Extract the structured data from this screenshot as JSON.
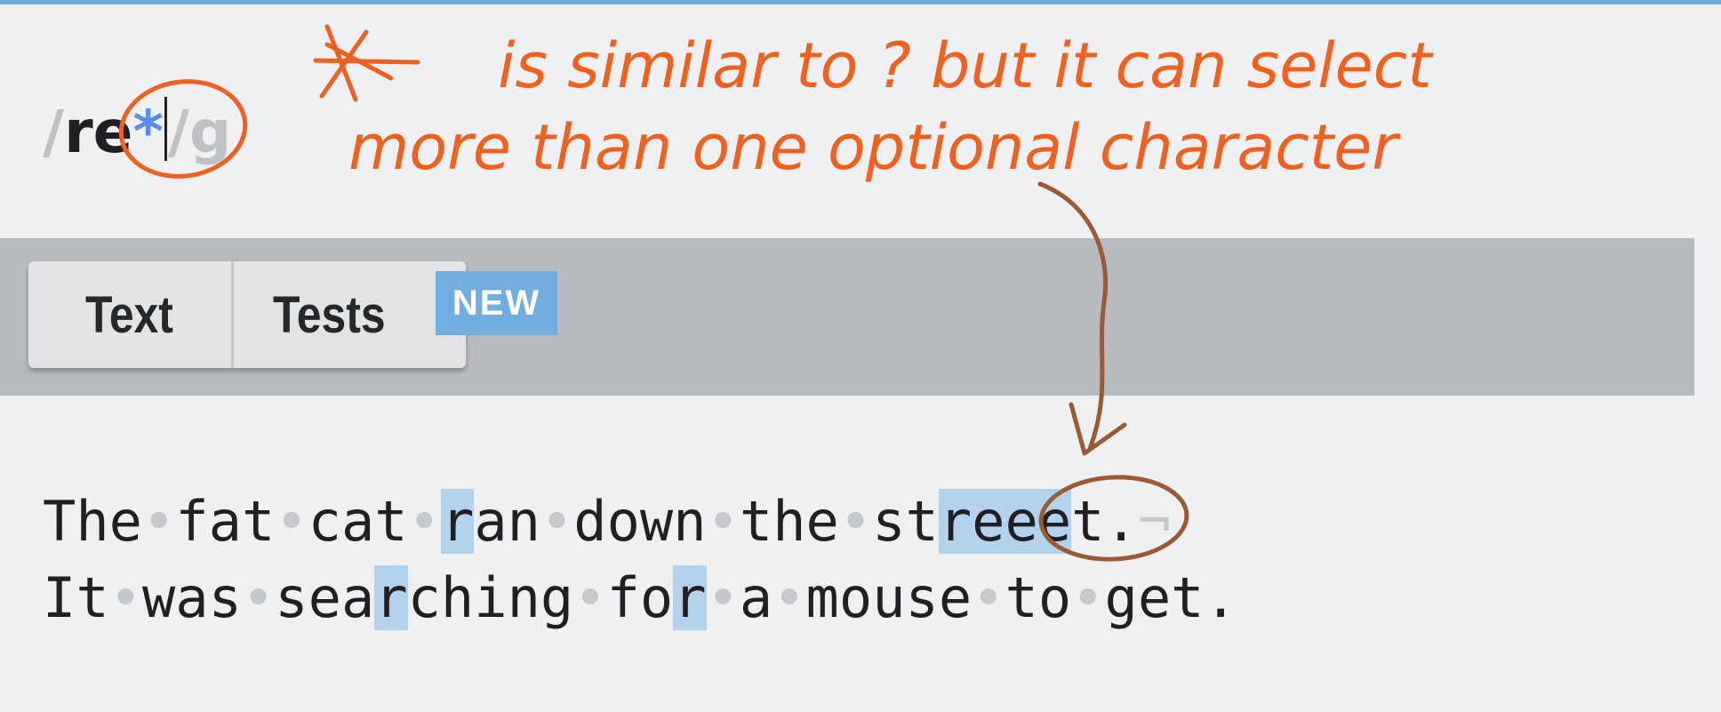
{
  "colors": {
    "accent": "#72ade0",
    "match_highlight": "#b3d2ec",
    "annotation_orange": "#f0601e",
    "annotation_brown": "#9c5a34"
  },
  "regex": {
    "open_delimiter": "/",
    "pattern_literal": "re",
    "quantifier": "*",
    "close_delimiter": "/",
    "flags": "g"
  },
  "tabs": [
    {
      "label": "Text"
    },
    {
      "label": "Tests"
    }
  ],
  "badge": {
    "label": "NEW"
  },
  "test_text": {
    "line1": [
      {
        "t": "The",
        "hl": false
      },
      {
        "t": "•",
        "ws": true
      },
      {
        "t": "fat",
        "hl": false
      },
      {
        "t": "•",
        "ws": true
      },
      {
        "t": "cat",
        "hl": false
      },
      {
        "t": "•",
        "ws": true
      },
      {
        "t": "r",
        "hl": true
      },
      {
        "t": "an",
        "hl": false
      },
      {
        "t": "•",
        "ws": true
      },
      {
        "t": "down",
        "hl": false
      },
      {
        "t": "•",
        "ws": true
      },
      {
        "t": "the",
        "hl": false
      },
      {
        "t": "•",
        "ws": true
      },
      {
        "t": "st",
        "hl": false
      },
      {
        "t": "reee",
        "hl": true
      },
      {
        "t": "t.",
        "hl": false
      },
      {
        "t": "¬",
        "ws": true
      }
    ],
    "line2": [
      {
        "t": "It",
        "hl": false
      },
      {
        "t": "•",
        "ws": true
      },
      {
        "t": "was",
        "hl": false
      },
      {
        "t": "•",
        "ws": true
      },
      {
        "t": "sea",
        "hl": false
      },
      {
        "t": "r",
        "hl": true
      },
      {
        "t": "ching",
        "hl": false
      },
      {
        "t": "•",
        "ws": true
      },
      {
        "t": "fo",
        "hl": false
      },
      {
        "t": "r",
        "hl": true
      },
      {
        "t": "•",
        "ws": true
      },
      {
        "t": "a",
        "hl": false
      },
      {
        "t": "•",
        "ws": true
      },
      {
        "t": "mouse",
        "hl": false
      },
      {
        "t": "•",
        "ws": true
      },
      {
        "t": "to",
        "hl": false
      },
      {
        "t": "•",
        "ws": true
      },
      {
        "t": "get.",
        "hl": false
      }
    ]
  },
  "annotation": {
    "symbol": "*",
    "line1": "is similar to ? but it can select",
    "line2": "more than one optional character"
  }
}
